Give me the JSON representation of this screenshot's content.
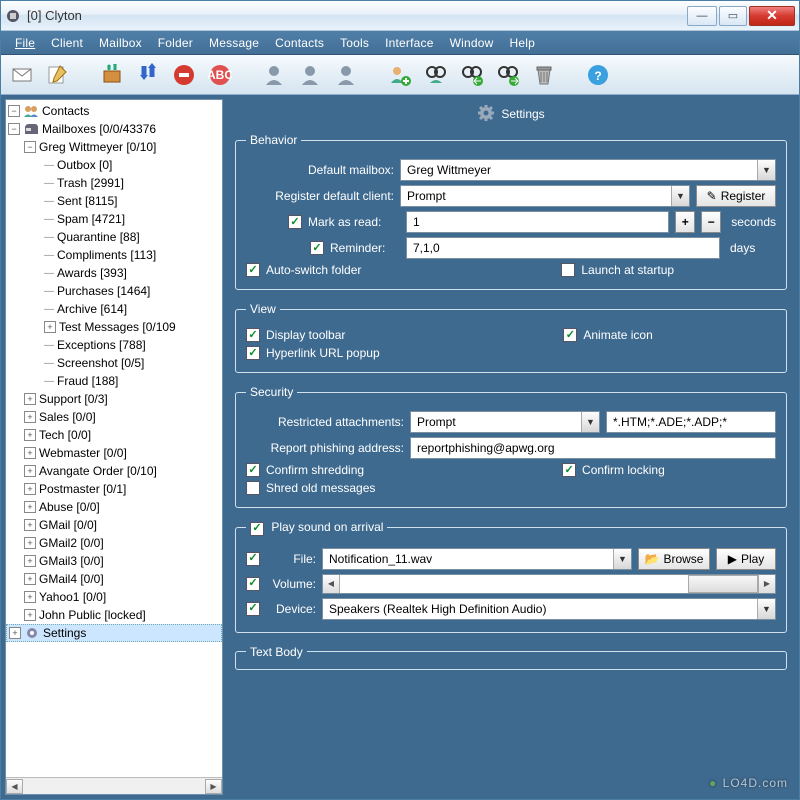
{
  "window": {
    "title": "[0] Clyton"
  },
  "menus": [
    "File",
    "Client",
    "Mailbox",
    "Folder",
    "Message",
    "Contacts",
    "Tools",
    "Interface",
    "Window",
    "Help"
  ],
  "tree": {
    "contacts": "Contacts",
    "mailboxes": "Mailboxes [0/0/43376",
    "greg": "Greg Wittmeyer [0/10]",
    "folders": [
      "Outbox [0]",
      "Trash [2991]",
      "Sent [8115]",
      "Spam [4721]",
      "Quarantine [88]",
      "Compliments [113]",
      "Awards [393]",
      "Purchases [1464]",
      "Archive [614]",
      "Test Messages [0/109",
      "Exceptions [788]",
      "Screenshot [0/5]",
      "Fraud [188]"
    ],
    "folders_expand": [
      false,
      false,
      false,
      false,
      false,
      false,
      false,
      false,
      false,
      true,
      false,
      false,
      false
    ],
    "accounts": [
      "Support [0/3]",
      "Sales [0/0]",
      "Tech [0/0]",
      "Webmaster [0/0]",
      "Avangate Order [0/10]",
      "Postmaster [0/1]",
      "Abuse [0/0]",
      "GMail [0/0]",
      "GMail2 [0/0]",
      "GMail3 [0/0]",
      "GMail4 [0/0]",
      "Yahoo1 [0/0]",
      "John Public [locked]"
    ],
    "settings": "Settings"
  },
  "settings": {
    "title": "Settings",
    "behavior": {
      "legend": "Behavior",
      "default_mailbox_label": "Default mailbox:",
      "default_mailbox_value": "Greg Wittmeyer",
      "register_label": "Register default client:",
      "register_value": "Prompt",
      "register_btn": "Register",
      "mark_as_read_label": "Mark as read:",
      "mark_as_read_value": "1",
      "seconds": "seconds",
      "reminder_label": "Reminder:",
      "reminder_value": "7,1,0",
      "days": "days",
      "auto_switch": "Auto-switch folder",
      "launch_startup": "Launch at startup"
    },
    "view": {
      "legend": "View",
      "display_toolbar": "Display toolbar",
      "animate_icon": "Animate icon",
      "hyperlink_popup": "Hyperlink URL popup"
    },
    "security": {
      "legend": "Security",
      "restricted_label": "Restricted attachments:",
      "restricted_value": "Prompt",
      "restricted_ext": "*.HTM;*.ADE;*.ADP;*",
      "phishing_label": "Report phishing address:",
      "phishing_value": "reportphishing@apwg.org",
      "confirm_shredding": "Confirm shredding",
      "confirm_locking": "Confirm locking",
      "shred_old": "Shred old messages"
    },
    "sound": {
      "legend": "Play sound on arrival",
      "file_label": "File:",
      "file_value": "Notification_11.wav",
      "browse": "Browse",
      "play": "Play",
      "volume_label": "Volume:",
      "device_label": "Device:",
      "device_value": "Speakers (Realtek High Definition Audio)"
    },
    "textbody": {
      "legend": "Text Body"
    }
  },
  "watermark": "LO4D.com"
}
